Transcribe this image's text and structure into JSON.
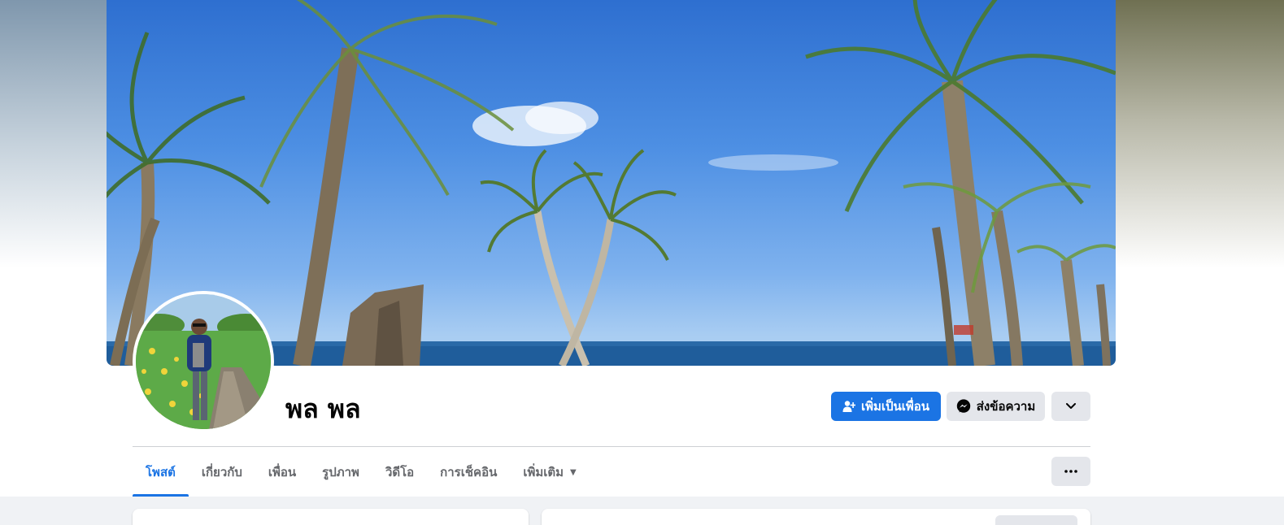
{
  "profile": {
    "name": "พล พล"
  },
  "actions": {
    "add_friend_label": "เพิ่มเป็นเพื่อน",
    "message_label": "ส่งข้อความ"
  },
  "tabs": [
    {
      "label": "โพสต์",
      "active": true
    },
    {
      "label": "เกี่ยวกับ",
      "active": false
    },
    {
      "label": "เพื่อน",
      "active": false
    },
    {
      "label": "รูปภาพ",
      "active": false
    },
    {
      "label": "วิดีโอ",
      "active": false
    },
    {
      "label": "การเช็คอิน",
      "active": false
    },
    {
      "label": "เพิ่มเติม",
      "active": false
    }
  ],
  "icons": {
    "add_friend": "person-add-icon",
    "message": "messenger-icon",
    "dropdown": "chevron-down-icon",
    "more": "ellipsis-icon",
    "more_tab": "caret-down-icon"
  },
  "colors": {
    "accent": "#1b74e4",
    "secondary_button": "#e4e6eb",
    "tab_inactive": "#65676b",
    "content_background": "#f0f2f5"
  }
}
